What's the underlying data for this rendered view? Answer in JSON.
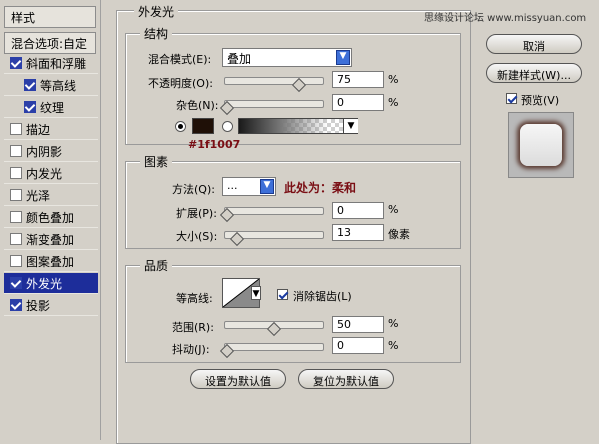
{
  "sidebar": {
    "header": "样式",
    "blend": "混合选项:自定",
    "items": [
      {
        "label": "斜面和浮雕",
        "checked": true,
        "sub": false,
        "selected": false
      },
      {
        "label": "等高线",
        "checked": true,
        "sub": true,
        "selected": false
      },
      {
        "label": "纹理",
        "checked": true,
        "sub": true,
        "selected": false
      },
      {
        "label": "描边",
        "checked": false,
        "sub": false,
        "selected": false
      },
      {
        "label": "内阴影",
        "checked": false,
        "sub": false,
        "selected": false
      },
      {
        "label": "内发光",
        "checked": false,
        "sub": false,
        "selected": false
      },
      {
        "label": "光泽",
        "checked": false,
        "sub": false,
        "selected": false
      },
      {
        "label": "颜色叠加",
        "checked": false,
        "sub": false,
        "selected": false
      },
      {
        "label": "渐变叠加",
        "checked": false,
        "sub": false,
        "selected": false
      },
      {
        "label": "图案叠加",
        "checked": false,
        "sub": false,
        "selected": false
      },
      {
        "label": "外发光",
        "checked": true,
        "sub": false,
        "selected": true
      },
      {
        "label": "投影",
        "checked": true,
        "sub": false,
        "selected": false
      }
    ]
  },
  "outer_title": "外发光",
  "structure": {
    "title": "结构",
    "blend_mode_label": "混合模式(E):",
    "blend_mode_value": "叠加",
    "opacity_label": "不透明度(O):",
    "opacity_value": "75",
    "noise_label": "杂色(N):",
    "noise_value": "0",
    "percent": "%",
    "color_hex": "#1f1007",
    "color_annotation": "#1f1007"
  },
  "elements": {
    "title": "图素",
    "method_label": "方法(Q):",
    "method_value": "...",
    "method_annotation": "此处为：柔和",
    "spread_label": "扩展(P):",
    "spread_value": "0",
    "size_label": "大小(S):",
    "size_value": "13",
    "size_unit": "像素"
  },
  "quality": {
    "title": "品质",
    "contour_label": "等高线:",
    "antialias_label": "消除锯齿(L)",
    "antialias_checked": true,
    "range_label": "范围(R):",
    "range_value": "50",
    "jitter_label": "抖动(J):",
    "jitter_value": "0"
  },
  "actions": {
    "make_default": "设置为默认值",
    "reset_default": "复位为默认值",
    "ok": "确定",
    "cancel": "取消",
    "new_style": "新建样式(W)...",
    "preview": "预览(V)",
    "watermark": "思缘设计论坛 www.missyuan.com"
  }
}
